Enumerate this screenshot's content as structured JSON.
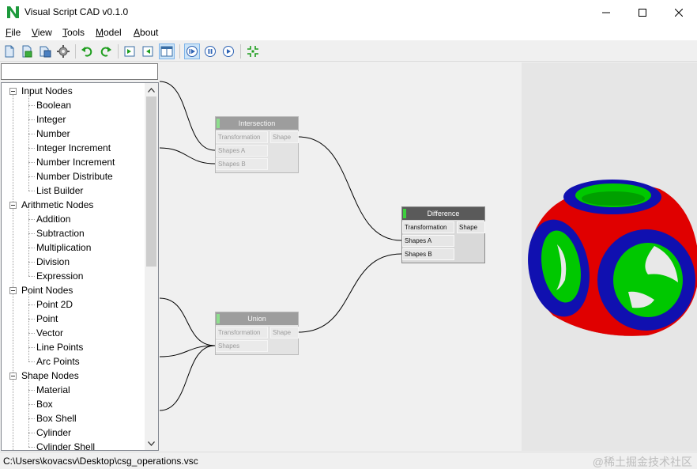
{
  "window": {
    "title": "Visual Script CAD v0.1.0"
  },
  "menu": {
    "file": {
      "accel": "F",
      "rest": "ile"
    },
    "view": {
      "accel": "V",
      "rest": "iew"
    },
    "tools": {
      "accel": "T",
      "rest": "ools"
    },
    "model": {
      "accel": "M",
      "rest": "odel"
    },
    "about": {
      "accel": "A",
      "rest": "bout"
    }
  },
  "toolbar": {
    "icons": [
      "new-file-icon",
      "open-file-icon",
      "save-file-icon",
      "settings-gear-icon",
      "undo-icon",
      "redo-icon",
      "import-icon",
      "export-icon",
      "split-view-icon",
      "step-icon",
      "pause-icon",
      "play-icon",
      "fit-view-icon"
    ]
  },
  "search": {
    "value": "",
    "placeholder": ""
  },
  "tree": {
    "groups": [
      {
        "label": "Input Nodes",
        "items": [
          "Boolean",
          "Integer",
          "Number",
          "Integer Increment",
          "Number Increment",
          "Number Distribute",
          "List Builder"
        ]
      },
      {
        "label": "Arithmetic Nodes",
        "items": [
          "Addition",
          "Subtraction",
          "Multiplication",
          "Division",
          "Expression"
        ]
      },
      {
        "label": "Point Nodes",
        "items": [
          "Point 2D",
          "Point",
          "Vector",
          "Line Points",
          "Arc Points"
        ]
      },
      {
        "label": "Shape Nodes",
        "items": [
          "Material",
          "Box",
          "Box Shell",
          "Cylinder",
          "Cylinder Shell"
        ]
      }
    ]
  },
  "graph": {
    "intersection": {
      "title": "Intersection",
      "inputs": [
        "Transformation",
        "Shapes A",
        "Shapes B"
      ],
      "output": "Shape"
    },
    "difference": {
      "title": "Difference",
      "inputs": [
        "Transformation",
        "Shapes A",
        "Shapes B"
      ],
      "output": "Shape"
    },
    "union": {
      "title": "Union",
      "inputs": [
        "Transformation",
        "Shapes"
      ],
      "output": "Shape"
    }
  },
  "colors": {
    "accent_green": "#3dd13d",
    "model_red": "#e00000",
    "model_blue": "#1010b0",
    "model_green": "#00c800"
  },
  "status": {
    "path": "C:\\Users\\kovacsv\\Desktop\\csg_operations.vsc",
    "watermark": "@稀土掘金技术社区"
  }
}
